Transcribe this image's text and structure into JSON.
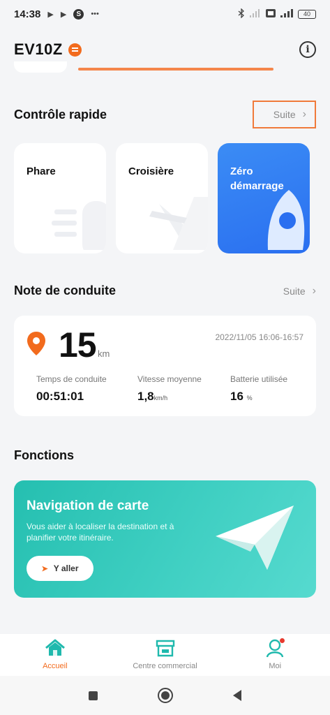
{
  "status_bar": {
    "time": "14:38",
    "left_icons": [
      "play-icon",
      "play-icon",
      "s-app-icon",
      "more-dots-icon"
    ],
    "s_app_letter": "S",
    "dots": "•••",
    "battery_level": "40",
    "right_icons": [
      "bluetooth-icon",
      "signal-icon",
      "wifi-icon",
      "signal-icon",
      "battery-icon"
    ]
  },
  "header": {
    "title": "EV10Z",
    "info_icon": "info-icon",
    "info_glyph": "i"
  },
  "quick_control": {
    "title": "Contrôle rapide",
    "more_label": "Suite",
    "cards": [
      {
        "label": "Phare",
        "icon": "headlight-icon",
        "active": false
      },
      {
        "label": "Croisière",
        "icon": "cruise-icon",
        "active": false
      },
      {
        "label": "Zéro démarrage",
        "line1": "Zéro",
        "line2": "démarrage",
        "icon": "rocket-icon",
        "active": true
      }
    ]
  },
  "driving_note": {
    "title": "Note de conduite",
    "more_label": "Suite",
    "distance": "15",
    "distance_unit": "km",
    "date_range": "2022/11/05 16:06-16:57",
    "metrics": [
      {
        "label": "Temps de conduite",
        "value": "00:51:01",
        "unit": ""
      },
      {
        "label": "Vitesse moyenne",
        "value": "1,8",
        "unit": "km/h"
      },
      {
        "label": "Batterie utilisée",
        "value": "16",
        "unit": "%"
      }
    ]
  },
  "functions": {
    "title": "Fonctions",
    "nav_card": {
      "title": "Navigation de carte",
      "description": "Vous aider à localiser la destination et à planifier votre itinéraire.",
      "button_label": "Y aller"
    }
  },
  "bottom_nav": [
    {
      "label": "Accueil",
      "icon": "home-icon",
      "active": true
    },
    {
      "label": "Centre commercial",
      "icon": "store-icon",
      "active": false
    },
    {
      "label": "Moi",
      "icon": "profile-icon",
      "active": false,
      "badge": true
    }
  ],
  "system_nav": [
    "recents-button",
    "home-button",
    "back-button"
  ],
  "colors": {
    "accent": "#f26b1d",
    "blue_card": "#2f7cf2",
    "teal_card": "#2fc7b8",
    "highlight_box": "#f07a3a"
  }
}
